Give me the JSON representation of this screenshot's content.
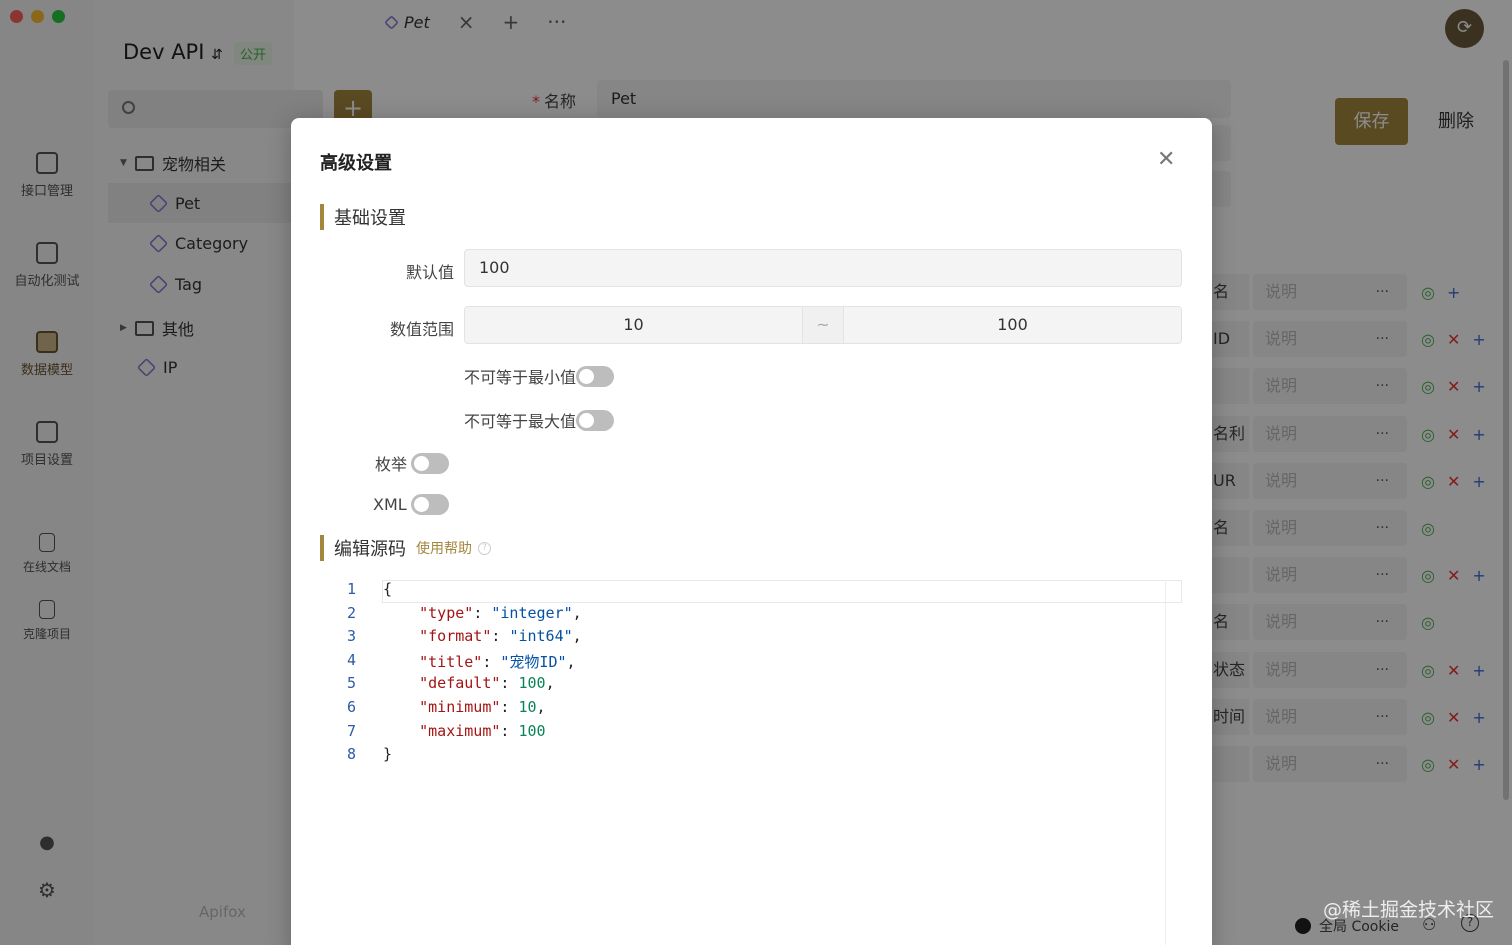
{
  "app": {
    "project_name": "Dev API",
    "project_badge": "公开",
    "rail": [
      {
        "label": "接口管理"
      },
      {
        "label": "自动化测试"
      },
      {
        "label": "数据模型"
      },
      {
        "label": "项目设置"
      },
      {
        "label": "在线文档"
      },
      {
        "label": "克隆项目"
      }
    ],
    "tree": [
      {
        "label": "宠物相关"
      },
      {
        "label": "Pet"
      },
      {
        "label": "Category"
      },
      {
        "label": "Tag"
      },
      {
        "label": "其他"
      },
      {
        "label": "IP"
      }
    ],
    "brand": "Apifox",
    "tab_label": "Pet",
    "name_label": "名称",
    "name_value": "Pet",
    "save_label": "保存",
    "delete_label": "删除",
    "properties": [
      {
        "name": "名",
        "desc": "说明",
        "actions": [
          "eye",
          "plus"
        ]
      },
      {
        "name": "ID",
        "desc": "说明",
        "actions": [
          "eye",
          "x",
          "plus"
        ]
      },
      {
        "name": "",
        "desc": "说明",
        "actions": [
          "eye",
          "x",
          "plus"
        ]
      },
      {
        "name": "名利",
        "desc": "说明",
        "actions": [
          "eye",
          "x",
          "plus"
        ]
      },
      {
        "name": "UR",
        "desc": "说明",
        "actions": [
          "eye",
          "x",
          "plus"
        ]
      },
      {
        "name": "名",
        "desc": "说明",
        "actions": [
          "eye"
        ]
      },
      {
        "name": "",
        "desc": "说明",
        "actions": [
          "eye",
          "x",
          "plus"
        ]
      },
      {
        "name": "名",
        "desc": "说明",
        "actions": [
          "eye"
        ]
      },
      {
        "name": "状态",
        "desc": "说明",
        "actions": [
          "eye",
          "x",
          "plus"
        ]
      },
      {
        "name": "时间",
        "desc": "说明",
        "actions": [
          "eye",
          "x",
          "plus"
        ]
      },
      {
        "name": "",
        "desc": "说明",
        "actions": [
          "eye",
          "x",
          "plus"
        ]
      }
    ],
    "more_label": "···",
    "cookie_label": "全局 Cookie",
    "watermark": "@稀土掘金技术社区"
  },
  "modal": {
    "title": "高级设置",
    "basic_section": "基础设置",
    "default_label": "默认值",
    "default_value": "100",
    "range_label": "数值范围",
    "range_min": "10",
    "range_sep": "~",
    "range_max": "100",
    "not_equal_min": "不可等于最小值",
    "not_equal_max": "不可等于最大值",
    "enum_label": "枚举",
    "xml_label": "XML",
    "source_section": "编辑源码",
    "help_link": "使用帮助",
    "code": [
      {
        "ln": "1",
        "parts": [
          [
            "p",
            "{"
          ]
        ]
      },
      {
        "ln": "2",
        "parts": [
          [
            "p",
            "    "
          ],
          [
            "k",
            "\"type\""
          ],
          [
            "p",
            ": "
          ],
          [
            "s",
            "\"integer\""
          ],
          [
            "p",
            ","
          ]
        ]
      },
      {
        "ln": "3",
        "parts": [
          [
            "p",
            "    "
          ],
          [
            "k",
            "\"format\""
          ],
          [
            "p",
            ": "
          ],
          [
            "s",
            "\"int64\""
          ],
          [
            "p",
            ","
          ]
        ]
      },
      {
        "ln": "4",
        "parts": [
          [
            "p",
            "    "
          ],
          [
            "k",
            "\"title\""
          ],
          [
            "p",
            ": "
          ],
          [
            "s",
            "\"宠物ID\""
          ],
          [
            "p",
            ","
          ]
        ]
      },
      {
        "ln": "5",
        "parts": [
          [
            "p",
            "    "
          ],
          [
            "k",
            "\"default\""
          ],
          [
            "p",
            ": "
          ],
          [
            "n",
            "100"
          ],
          [
            "p",
            ","
          ]
        ]
      },
      {
        "ln": "6",
        "parts": [
          [
            "p",
            "    "
          ],
          [
            "k",
            "\"minimum\""
          ],
          [
            "p",
            ": "
          ],
          [
            "n",
            "10"
          ],
          [
            "p",
            ","
          ]
        ]
      },
      {
        "ln": "7",
        "parts": [
          [
            "p",
            "    "
          ],
          [
            "k",
            "\"maximum\""
          ],
          [
            "p",
            ": "
          ],
          [
            "n",
            "100"
          ]
        ]
      },
      {
        "ln": "8",
        "parts": [
          [
            "p",
            "}"
          ]
        ]
      }
    ]
  },
  "colors": {
    "accent": "#a4873e",
    "json_key": "#a31515",
    "json_string": "#0451a5",
    "json_number": "#098658"
  }
}
